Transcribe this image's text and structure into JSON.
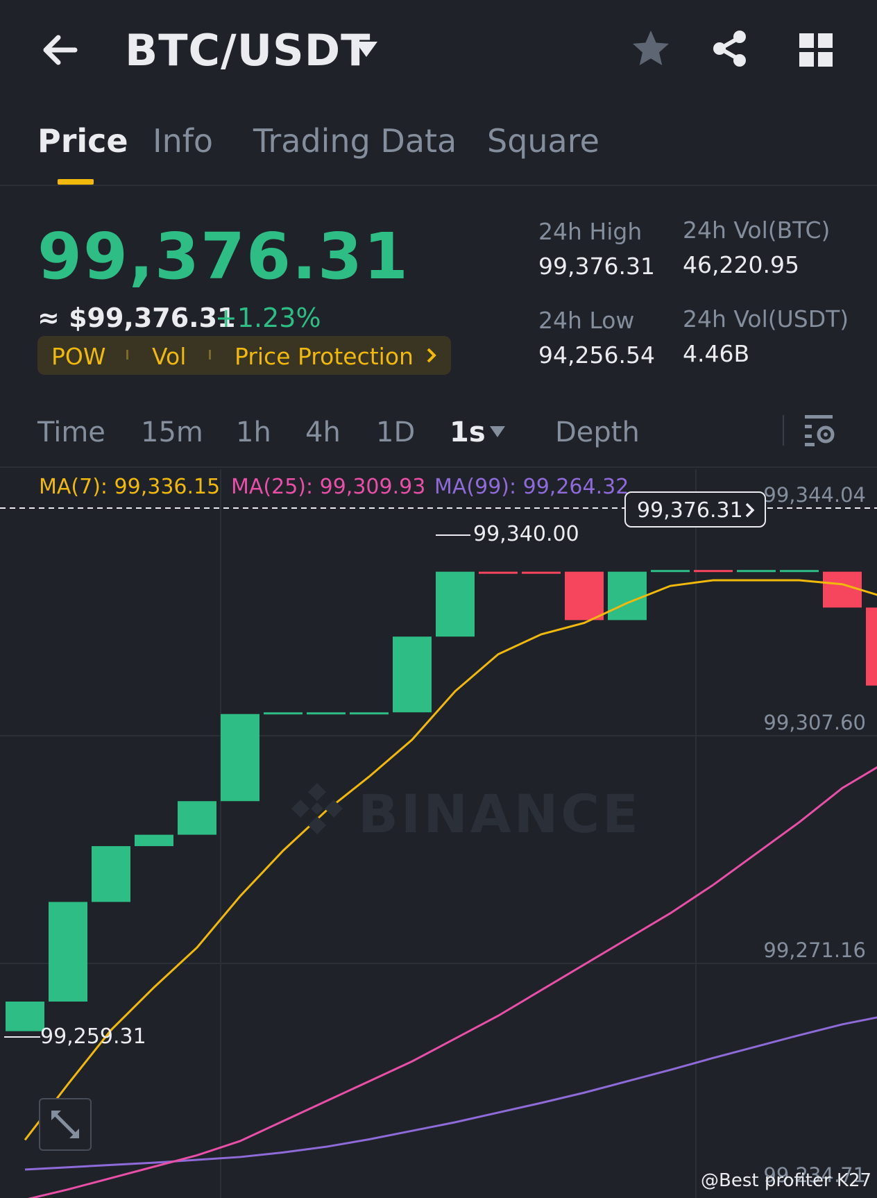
{
  "header": {
    "pair": "BTC/USDT",
    "icons": [
      "back-arrow-icon",
      "caret-down-icon",
      "star-icon",
      "share-icon",
      "grid-icon"
    ]
  },
  "tabs": [
    {
      "label": "Price",
      "active": true
    },
    {
      "label": "Info",
      "active": false
    },
    {
      "label": "Trading Data",
      "active": false
    },
    {
      "label": "Square",
      "active": false
    }
  ],
  "ticker": {
    "last_price": "99,376.31",
    "approx_usd": "≈ $99,376.31",
    "change_pct": "+1.23%",
    "tags": [
      "POW",
      "Vol",
      "Price Protection"
    ],
    "stats": {
      "high_label": "24h High",
      "high_value": "99,376.31",
      "low_label": "24h Low",
      "low_value": "94,256.54",
      "vol_btc_label": "24h Vol(BTC)",
      "vol_btc_value": "46,220.95",
      "vol_usdt_label": "24h Vol(USDT)",
      "vol_usdt_value": "4.46B"
    }
  },
  "intervals": {
    "items": [
      "Time",
      "15m",
      "1h",
      "4h",
      "1D",
      "1s",
      "Depth"
    ],
    "selected": "1s"
  },
  "ma_legend": {
    "ma7": "MA(7): 99,336.15",
    "ma25": "MA(25): 99,309.93",
    "ma99": "MA(99): 99,264.32"
  },
  "colors": {
    "up": "#2ebd85",
    "down": "#f6465d",
    "accent": "#f0b90b",
    "ma7": "#f0b90b",
    "ma25": "#e84fa6",
    "ma99": "#8e6bd8"
  },
  "chart_data": {
    "type": "candlestick",
    "y_ticks": [
      "99,344.04",
      "99,307.60",
      "99,271.16",
      "99,234.71"
    ],
    "ylim": [
      99230,
      99358
    ],
    "last_price_flag": "99,376.31",
    "high_marker": "99,340.00",
    "low_marker": "99,259.31",
    "candles": [
      {
        "o": 99259.3,
        "c": 99264.5,
        "h": 99264.5,
        "l": 99259.3
      },
      {
        "o": 99264.5,
        "c": 99282.0,
        "h": 99282.0,
        "l": 99264.5
      },
      {
        "o": 99282.0,
        "c": 99291.8,
        "h": 99291.8,
        "l": 99282.0
      },
      {
        "o": 99291.8,
        "c": 99293.8,
        "h": 99293.8,
        "l": 99291.8
      },
      {
        "o": 99293.8,
        "c": 99299.7,
        "h": 99299.7,
        "l": 99293.8
      },
      {
        "o": 99299.7,
        "c": 99315.0,
        "h": 99315.0,
        "l": 99299.7
      },
      {
        "o": 99315.0,
        "c": 99315.3,
        "h": 99315.3,
        "l": 99315.0
      },
      {
        "o": 99315.0,
        "c": 99315.3,
        "h": 99315.3,
        "l": 99315.0
      },
      {
        "o": 99315.0,
        "c": 99315.3,
        "h": 99315.3,
        "l": 99315.0
      },
      {
        "o": 99315.3,
        "c": 99328.6,
        "h": 99328.6,
        "l": 99315.3
      },
      {
        "o": 99328.6,
        "c": 99340.0,
        "h": 99340.0,
        "l": 99328.6
      },
      {
        "o": 99340.0,
        "c": 99339.8,
        "h": 99340.0,
        "l": 99339.8
      },
      {
        "o": 99340.0,
        "c": 99339.8,
        "h": 99340.0,
        "l": 99339.8
      },
      {
        "o": 99340.0,
        "c": 99331.5,
        "h": 99340.0,
        "l": 99331.5
      },
      {
        "o": 99331.5,
        "c": 99340.0,
        "h": 99340.0,
        "l": 99331.5
      },
      {
        "o": 99340.0,
        "c": 99340.3,
        "h": 99340.3,
        "l": 99340.0
      },
      {
        "o": 99340.3,
        "c": 99340.1,
        "h": 99340.3,
        "l": 99340.1
      },
      {
        "o": 99340.0,
        "c": 99340.3,
        "h": 99340.3,
        "l": 99340.0
      },
      {
        "o": 99340.0,
        "c": 99340.3,
        "h": 99340.3,
        "l": 99340.0
      },
      {
        "o": 99340.0,
        "c": 99333.7,
        "h": 99340.0,
        "l": 99333.7
      },
      {
        "o": 99333.7,
        "c": 99320.0,
        "h": 99333.7,
        "l": 99320.0
      }
    ],
    "ma7": [
      99240.2,
      99250.0,
      99259.5,
      99267.0,
      99274.0,
      99283.0,
      99291.0,
      99298.0,
      99304.0,
      99310.5,
      99319.0,
      99325.5,
      99329.0,
      99331.0,
      99334.5,
      99337.5,
      99338.5,
      99338.5,
      99338.5,
      99337.8,
      99335.5
    ],
    "ma25": [
      99229.7,
      99231.5,
      99233.5,
      99235.5,
      99237.5,
      99240.0,
      99243.5,
      99247.0,
      99250.5,
      99254.0,
      99258.0,
      99262.0,
      99266.5,
      99271.0,
      99275.5,
      99280.0,
      99285.0,
      99290.5,
      99296.0,
      99302.0,
      99306.5
    ],
    "ma99": [
      99235.0,
      99235.4,
      99235.8,
      99236.2,
      99236.7,
      99237.2,
      99238.0,
      99239.0,
      99240.3,
      99241.8,
      99243.3,
      99245.0,
      99246.7,
      99248.5,
      99250.5,
      99252.5,
      99254.6,
      99256.6,
      99258.6,
      99260.5,
      99262.0
    ]
  },
  "watermark": "BINANCE",
  "credit": "@Best profiter K27"
}
